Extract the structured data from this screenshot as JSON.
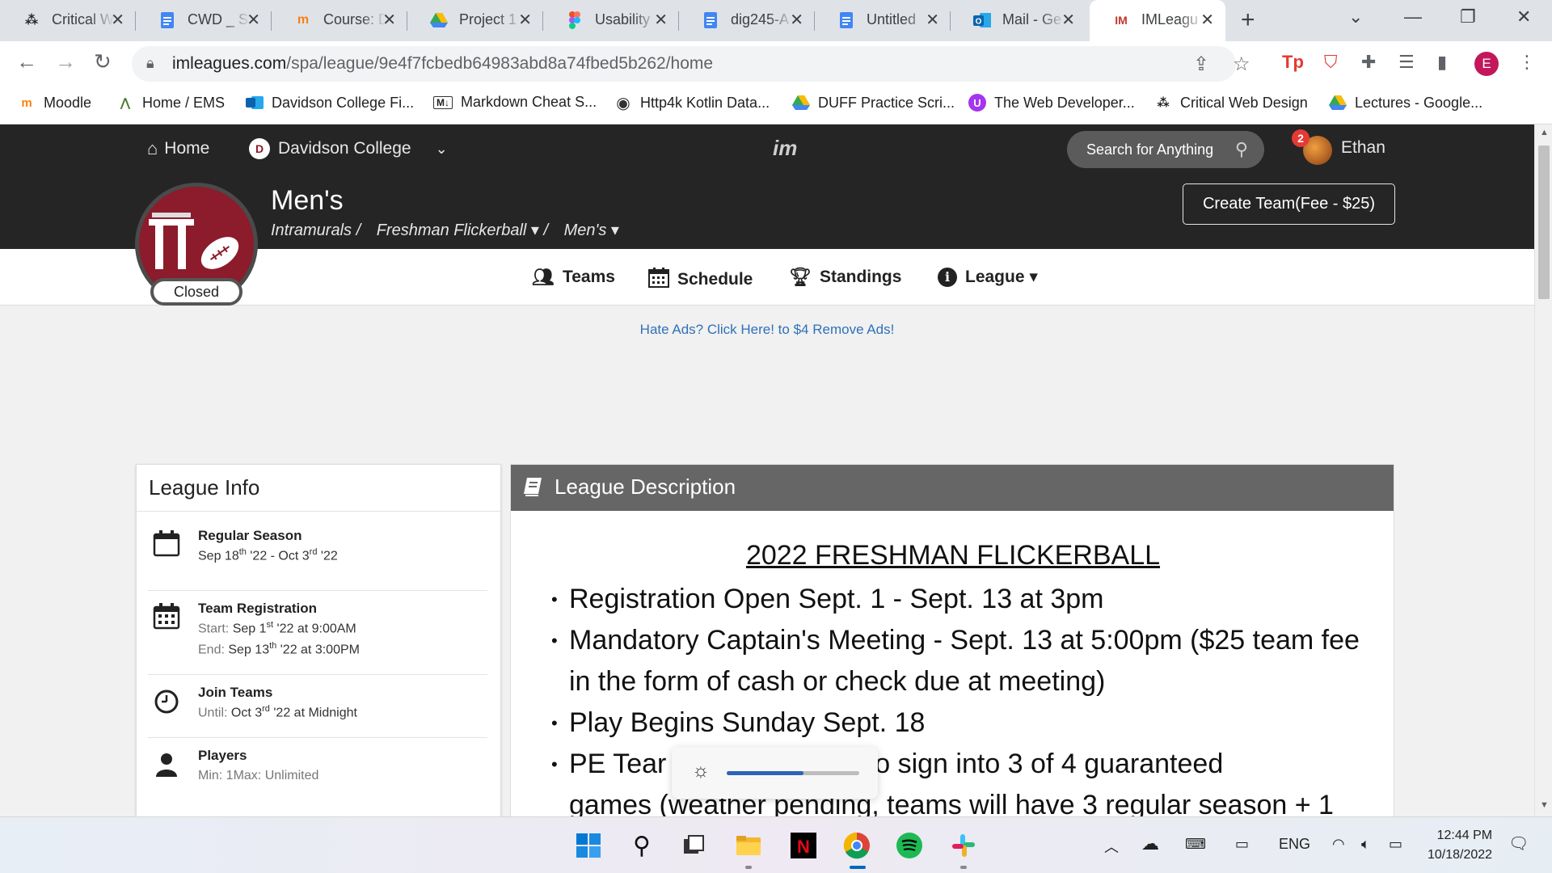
{
  "browser": {
    "tabs": [
      {
        "label": "Critical W",
        "icon": "dots-icon"
      },
      {
        "label": "CWD _ S",
        "icon": "docs-icon"
      },
      {
        "label": "Course: D",
        "icon": "moodle-icon"
      },
      {
        "label": "Project 1",
        "icon": "drive-icon"
      },
      {
        "label": "Usability",
        "icon": "figma-icon"
      },
      {
        "label": "dig245-A",
        "icon": "docs-icon"
      },
      {
        "label": "Untitled",
        "icon": "docs-icon"
      },
      {
        "label": "Mail - Ge",
        "icon": "outlook-icon"
      },
      {
        "label": "IMLeagu",
        "icon": "imleagues-icon",
        "active": true
      }
    ],
    "url_domain": "imleagues.com",
    "url_path": "/spa/league/9e4f7fcbedb64983abd8a74fbed5b262/home",
    "profile_initial": "E",
    "bookmarks": [
      {
        "label": "Moodle",
        "icon": "moodle-icon"
      },
      {
        "label": "Home / EMS",
        "icon": "ems-icon"
      },
      {
        "label": "Davidson College Fi...",
        "icon": "outlook-icon"
      },
      {
        "label": "Markdown Cheat S...",
        "icon": "markdown-icon"
      },
      {
        "label": "Http4k Kotlin Data...",
        "icon": "github-icon"
      },
      {
        "label": "DUFF Practice Scri...",
        "icon": "drive-icon"
      },
      {
        "label": "The Web Developer...",
        "icon": "udemy-icon"
      },
      {
        "label": "Critical Web Design",
        "icon": "dots-icon"
      },
      {
        "label": "Lectures - Google...",
        "icon": "drive-icon"
      }
    ]
  },
  "site": {
    "nav_home": "Home",
    "nav_school": "Davidson College",
    "search_placeholder": "Search for Anything",
    "notification_count": "2",
    "user_name": "Ethan",
    "league_title": "Men's",
    "crumb_1": "Intramurals /",
    "crumb_2": "Freshman Flickerball ▾ /",
    "crumb_3": "Men's ▾",
    "status": "Closed",
    "create_team": "Create Team(Fee - $25)",
    "tabs": {
      "teams": "Teams",
      "schedule": "Schedule",
      "standings": "Standings",
      "league": "League ▾"
    },
    "ad_text": "Hate Ads? Click Here! to $4 Remove Ads!"
  },
  "league_info": {
    "heading": "League Info",
    "regular_season": {
      "title": "Regular Season",
      "start_month": "Sep 18",
      "start_suffix": "th",
      "start_year": "'22 - Oct 3",
      "end_suffix": "rd",
      "end_year": "'22"
    },
    "registration": {
      "title": "Team Registration",
      "start_label": "Start:",
      "start_date": "Sep 1",
      "start_suffix": "st",
      "start_rest": "'22 at 9:00AM",
      "end_label": "End:",
      "end_date": "Sep 13",
      "end_suffix": "th",
      "end_rest": "'22 at 3:00PM"
    },
    "join": {
      "title": "Join Teams",
      "label": "Until:",
      "date": "Oct 3",
      "suffix": "rd",
      "rest": "'22 at Midnight"
    },
    "players": {
      "title": "Players",
      "value": "Min: 1Max: Unlimited"
    }
  },
  "description": {
    "heading": "League Description",
    "title": "2022 FRESHMAN FLICKERBALL",
    "items": [
      "Registration Open Sept. 1 - Sept. 13 at 3pm",
      "Mandatory Captain's Meeting - Sept. 13 at 5:00pm ($25 team fee in the form of cash or check due at meeting)",
      "Play Begins Sunday Sept. 18",
      "PE Tear",
      "s who sign into 3 of 4 guaranteed",
      "games (weather pending, teams will have 3 regular season + 1"
    ]
  },
  "brightness_level": 0.58,
  "taskbar": {
    "language": "ENG",
    "time": "12:44 PM",
    "date": "10/18/2022"
  }
}
